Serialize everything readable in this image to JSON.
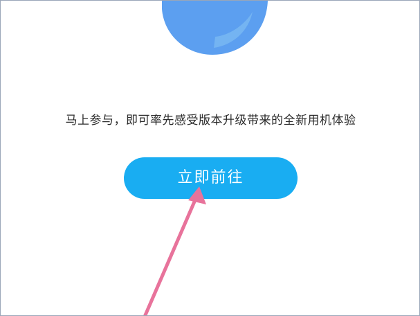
{
  "intro": {
    "text": "马上参与，即可率先感受版本升级带来的全新用机体验"
  },
  "cta": {
    "label": "立即前往"
  },
  "colors": {
    "button": "#19adf2",
    "circle_main": "#5aa0ef",
    "circle_light": "#9fd8f7",
    "arrow": "#e8739b"
  },
  "icons": {
    "hero": "blue-circle-illustration",
    "annotation": "pink-arrow"
  }
}
